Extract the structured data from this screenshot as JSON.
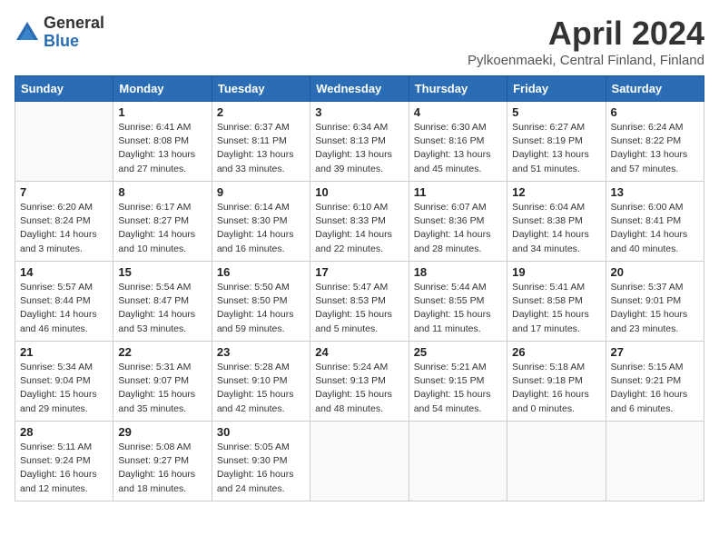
{
  "header": {
    "logo_general": "General",
    "logo_blue": "Blue",
    "month_title": "April 2024",
    "location": "Pylkoenmaeki, Central Finland, Finland"
  },
  "weekdays": [
    "Sunday",
    "Monday",
    "Tuesday",
    "Wednesday",
    "Thursday",
    "Friday",
    "Saturday"
  ],
  "weeks": [
    [
      {
        "day": "",
        "sunrise": "",
        "sunset": "",
        "daylight": ""
      },
      {
        "day": "1",
        "sunrise": "Sunrise: 6:41 AM",
        "sunset": "Sunset: 8:08 PM",
        "daylight": "Daylight: 13 hours and 27 minutes."
      },
      {
        "day": "2",
        "sunrise": "Sunrise: 6:37 AM",
        "sunset": "Sunset: 8:11 PM",
        "daylight": "Daylight: 13 hours and 33 minutes."
      },
      {
        "day": "3",
        "sunrise": "Sunrise: 6:34 AM",
        "sunset": "Sunset: 8:13 PM",
        "daylight": "Daylight: 13 hours and 39 minutes."
      },
      {
        "day": "4",
        "sunrise": "Sunrise: 6:30 AM",
        "sunset": "Sunset: 8:16 PM",
        "daylight": "Daylight: 13 hours and 45 minutes."
      },
      {
        "day": "5",
        "sunrise": "Sunrise: 6:27 AM",
        "sunset": "Sunset: 8:19 PM",
        "daylight": "Daylight: 13 hours and 51 minutes."
      },
      {
        "day": "6",
        "sunrise": "Sunrise: 6:24 AM",
        "sunset": "Sunset: 8:22 PM",
        "daylight": "Daylight: 13 hours and 57 minutes."
      }
    ],
    [
      {
        "day": "7",
        "sunrise": "Sunrise: 6:20 AM",
        "sunset": "Sunset: 8:24 PM",
        "daylight": "Daylight: 14 hours and 3 minutes."
      },
      {
        "day": "8",
        "sunrise": "Sunrise: 6:17 AM",
        "sunset": "Sunset: 8:27 PM",
        "daylight": "Daylight: 14 hours and 10 minutes."
      },
      {
        "day": "9",
        "sunrise": "Sunrise: 6:14 AM",
        "sunset": "Sunset: 8:30 PM",
        "daylight": "Daylight: 14 hours and 16 minutes."
      },
      {
        "day": "10",
        "sunrise": "Sunrise: 6:10 AM",
        "sunset": "Sunset: 8:33 PM",
        "daylight": "Daylight: 14 hours and 22 minutes."
      },
      {
        "day": "11",
        "sunrise": "Sunrise: 6:07 AM",
        "sunset": "Sunset: 8:36 PM",
        "daylight": "Daylight: 14 hours and 28 minutes."
      },
      {
        "day": "12",
        "sunrise": "Sunrise: 6:04 AM",
        "sunset": "Sunset: 8:38 PM",
        "daylight": "Daylight: 14 hours and 34 minutes."
      },
      {
        "day": "13",
        "sunrise": "Sunrise: 6:00 AM",
        "sunset": "Sunset: 8:41 PM",
        "daylight": "Daylight: 14 hours and 40 minutes."
      }
    ],
    [
      {
        "day": "14",
        "sunrise": "Sunrise: 5:57 AM",
        "sunset": "Sunset: 8:44 PM",
        "daylight": "Daylight: 14 hours and 46 minutes."
      },
      {
        "day": "15",
        "sunrise": "Sunrise: 5:54 AM",
        "sunset": "Sunset: 8:47 PM",
        "daylight": "Daylight: 14 hours and 53 minutes."
      },
      {
        "day": "16",
        "sunrise": "Sunrise: 5:50 AM",
        "sunset": "Sunset: 8:50 PM",
        "daylight": "Daylight: 14 hours and 59 minutes."
      },
      {
        "day": "17",
        "sunrise": "Sunrise: 5:47 AM",
        "sunset": "Sunset: 8:53 PM",
        "daylight": "Daylight: 15 hours and 5 minutes."
      },
      {
        "day": "18",
        "sunrise": "Sunrise: 5:44 AM",
        "sunset": "Sunset: 8:55 PM",
        "daylight": "Daylight: 15 hours and 11 minutes."
      },
      {
        "day": "19",
        "sunrise": "Sunrise: 5:41 AM",
        "sunset": "Sunset: 8:58 PM",
        "daylight": "Daylight: 15 hours and 17 minutes."
      },
      {
        "day": "20",
        "sunrise": "Sunrise: 5:37 AM",
        "sunset": "Sunset: 9:01 PM",
        "daylight": "Daylight: 15 hours and 23 minutes."
      }
    ],
    [
      {
        "day": "21",
        "sunrise": "Sunrise: 5:34 AM",
        "sunset": "Sunset: 9:04 PM",
        "daylight": "Daylight: 15 hours and 29 minutes."
      },
      {
        "day": "22",
        "sunrise": "Sunrise: 5:31 AM",
        "sunset": "Sunset: 9:07 PM",
        "daylight": "Daylight: 15 hours and 35 minutes."
      },
      {
        "day": "23",
        "sunrise": "Sunrise: 5:28 AM",
        "sunset": "Sunset: 9:10 PM",
        "daylight": "Daylight: 15 hours and 42 minutes."
      },
      {
        "day": "24",
        "sunrise": "Sunrise: 5:24 AM",
        "sunset": "Sunset: 9:13 PM",
        "daylight": "Daylight: 15 hours and 48 minutes."
      },
      {
        "day": "25",
        "sunrise": "Sunrise: 5:21 AM",
        "sunset": "Sunset: 9:15 PM",
        "daylight": "Daylight: 15 hours and 54 minutes."
      },
      {
        "day": "26",
        "sunrise": "Sunrise: 5:18 AM",
        "sunset": "Sunset: 9:18 PM",
        "daylight": "Daylight: 16 hours and 0 minutes."
      },
      {
        "day": "27",
        "sunrise": "Sunrise: 5:15 AM",
        "sunset": "Sunset: 9:21 PM",
        "daylight": "Daylight: 16 hours and 6 minutes."
      }
    ],
    [
      {
        "day": "28",
        "sunrise": "Sunrise: 5:11 AM",
        "sunset": "Sunset: 9:24 PM",
        "daylight": "Daylight: 16 hours and 12 minutes."
      },
      {
        "day": "29",
        "sunrise": "Sunrise: 5:08 AM",
        "sunset": "Sunset: 9:27 PM",
        "daylight": "Daylight: 16 hours and 18 minutes."
      },
      {
        "day": "30",
        "sunrise": "Sunrise: 5:05 AM",
        "sunset": "Sunset: 9:30 PM",
        "daylight": "Daylight: 16 hours and 24 minutes."
      },
      {
        "day": "",
        "sunrise": "",
        "sunset": "",
        "daylight": ""
      },
      {
        "day": "",
        "sunrise": "",
        "sunset": "",
        "daylight": ""
      },
      {
        "day": "",
        "sunrise": "",
        "sunset": "",
        "daylight": ""
      },
      {
        "day": "",
        "sunrise": "",
        "sunset": "",
        "daylight": ""
      }
    ]
  ]
}
